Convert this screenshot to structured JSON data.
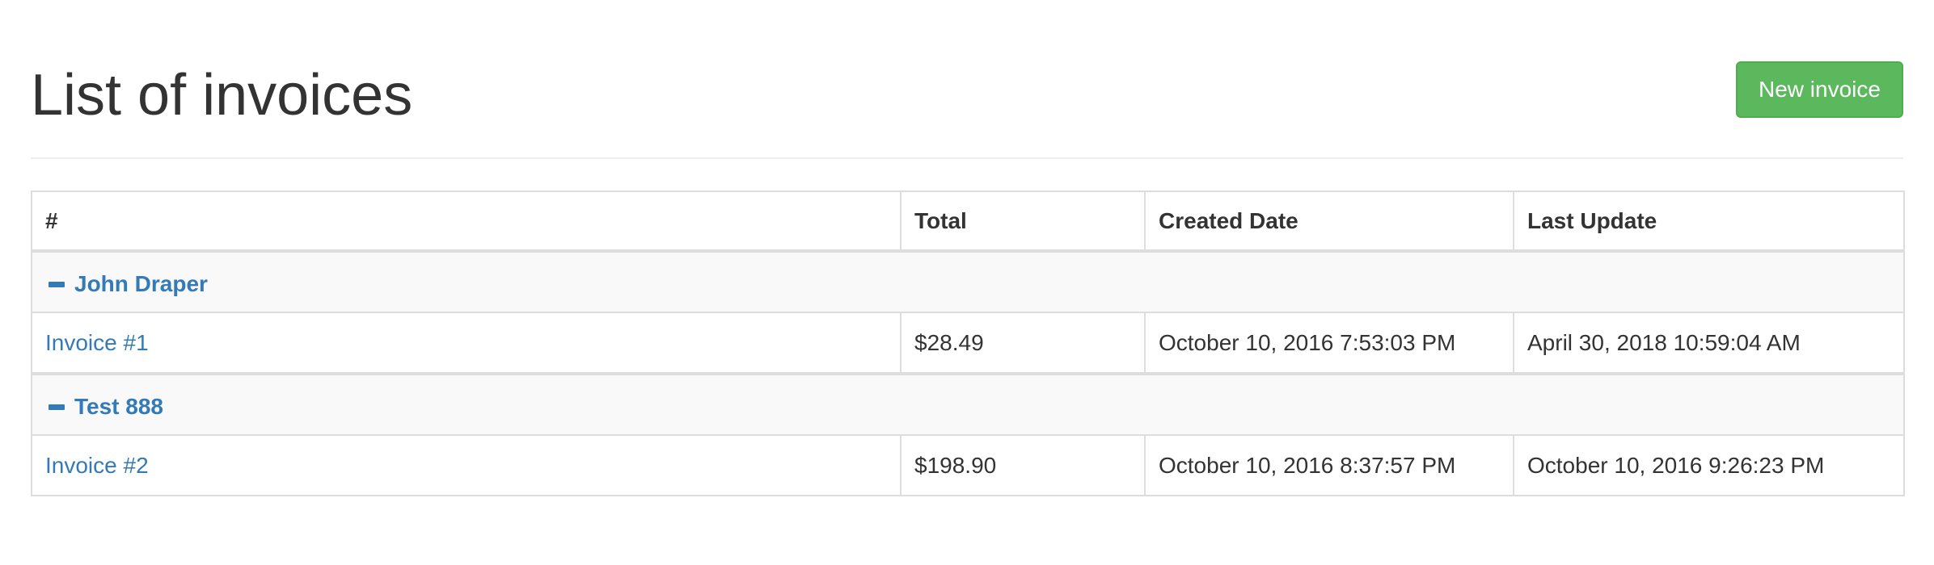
{
  "header": {
    "title": "List of invoices",
    "new_invoice_label": "New invoice"
  },
  "table": {
    "columns": [
      "#",
      "Total",
      "Created Date",
      "Last Update"
    ],
    "groups": [
      {
        "name": "John Draper",
        "toggle_icon": "minus-icon",
        "invoices": [
          {
            "label": "Invoice #1",
            "total": "$28.49",
            "created": "October 10, 2016 7:53:03 PM",
            "updated": "April 30, 2018 10:59:04 AM"
          }
        ]
      },
      {
        "name": "Test 888",
        "toggle_icon": "minus-icon",
        "invoices": [
          {
            "label": "Invoice #2",
            "total": "$198.90",
            "created": "October 10, 2016 8:37:57 PM",
            "updated": "October 10, 2016 9:26:23 PM"
          }
        ]
      }
    ]
  },
  "colors": {
    "primary_link": "#337ab7",
    "success_button": "#5cb85c",
    "group_row_bg": "#f9f9f9",
    "border": "#dddddd"
  }
}
